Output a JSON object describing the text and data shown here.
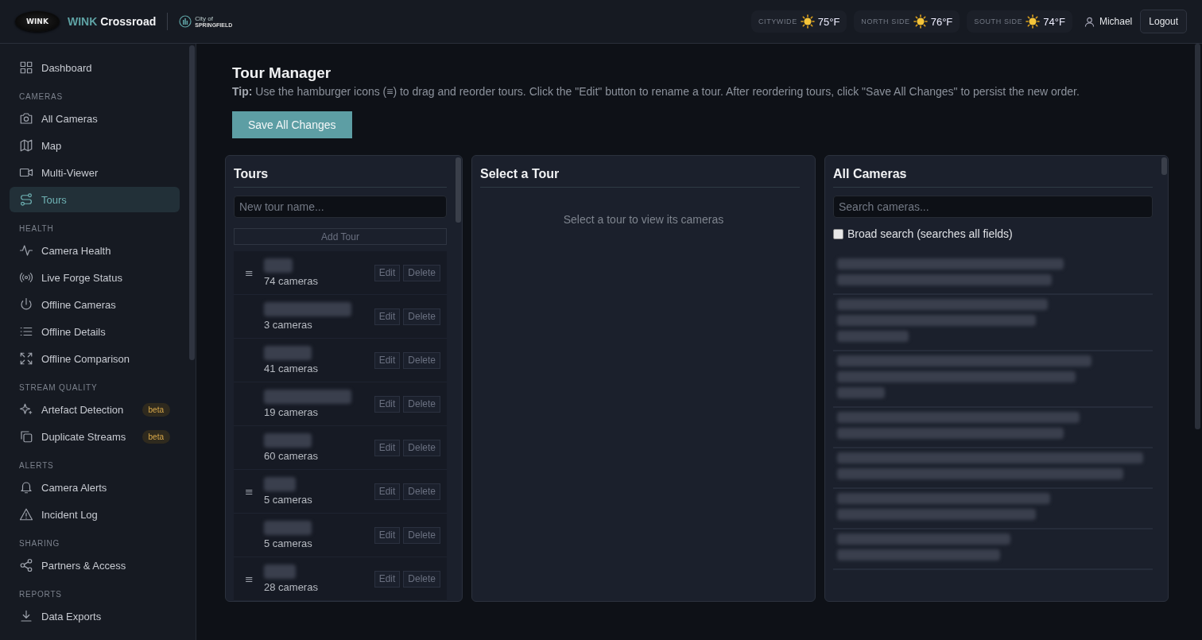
{
  "header": {
    "logo_text": "WINK",
    "brand_accent": "WINK",
    "brand_name": "Crossroad",
    "city_small": "City of",
    "city_name": "SPRINGFIELD",
    "weather": [
      {
        "label": "CITYWIDE",
        "temp": "75°F"
      },
      {
        "label": "NORTH SIDE",
        "temp": "76°F"
      },
      {
        "label": "SOUTH SIDE",
        "temp": "74°F"
      }
    ],
    "user": "Michael",
    "logout": "Logout"
  },
  "sidebar": {
    "sections": [
      {
        "items": [
          {
            "label": "Dashboard",
            "selected": false
          }
        ]
      },
      {
        "heading": "CAMERAS",
        "items": [
          {
            "label": "All Cameras",
            "selected": false
          },
          {
            "label": "Map",
            "selected": false
          },
          {
            "label": "Multi-Viewer",
            "selected": false
          },
          {
            "label": "Tours",
            "selected": true
          }
        ]
      },
      {
        "heading": "HEALTH",
        "items": [
          {
            "label": "Camera Health",
            "selected": false
          },
          {
            "label": "Live Forge Status",
            "selected": false
          },
          {
            "label": "Offline Cameras",
            "selected": false
          },
          {
            "label": "Offline Details",
            "selected": false
          },
          {
            "label": "Offline Comparison",
            "selected": false
          }
        ]
      },
      {
        "heading": "STREAM QUALITY",
        "items": [
          {
            "label": "Artefact Detection",
            "selected": false,
            "badge": "beta"
          },
          {
            "label": "Duplicate Streams",
            "selected": false,
            "badge": "beta"
          }
        ]
      },
      {
        "heading": "ALERTS",
        "items": [
          {
            "label": "Camera Alerts",
            "selected": false
          },
          {
            "label": "Incident Log",
            "selected": false
          }
        ]
      },
      {
        "heading": "SHARING",
        "items": [
          {
            "label": "Partners & Access",
            "selected": false
          }
        ]
      },
      {
        "heading": "REPORTS",
        "items": [
          {
            "label": "Data Exports",
            "selected": false
          }
        ]
      }
    ]
  },
  "page": {
    "title": "Tour Manager",
    "tip": "**Tip:** Use the hamburger icons (≡) to drag and reorder tours. Click the \"Edit\" button to rename a tour. After reordering tours, click \"Save All Changes\" to persist the new order.",
    "save_button": "Save All Changes"
  },
  "tours_panel": {
    "title": "Tours",
    "placeholder": "New tour name...",
    "add_button": "Add Tour",
    "tours": [
      {
        "handle": "≡",
        "count": "74 cameras",
        "edit": "Edit",
        "delete": "Delete"
      },
      {
        "count": "3 cameras",
        "edit": "Edit",
        "delete": "Delete"
      },
      {
        "count": "41 cameras",
        "edit": "Edit",
        "delete": "Delete"
      },
      {
        "count": "19 cameras",
        "edit": "Edit",
        "delete": "Delete"
      },
      {
        "count": "60 cameras",
        "edit": "Edit",
        "delete": "Delete"
      },
      {
        "handle": "≡",
        "count": "5 cameras",
        "edit": "Edit",
        "delete": "Delete"
      },
      {
        "count": "5 cameras",
        "edit": "Edit",
        "delete": "Delete"
      },
      {
        "handle": "≡",
        "count": "28 cameras",
        "edit": "Edit",
        "delete": "Delete"
      }
    ]
  },
  "tour_panel": {
    "title": "Select a Tour",
    "empty_message": "Select a tour to view its cameras"
  },
  "cameras_panel": {
    "title": "All Cameras",
    "placeholder": "Search cameras...",
    "broad_search": {
      "label": "Broad search (searches all fields)",
      "checked": false
    }
  }
}
